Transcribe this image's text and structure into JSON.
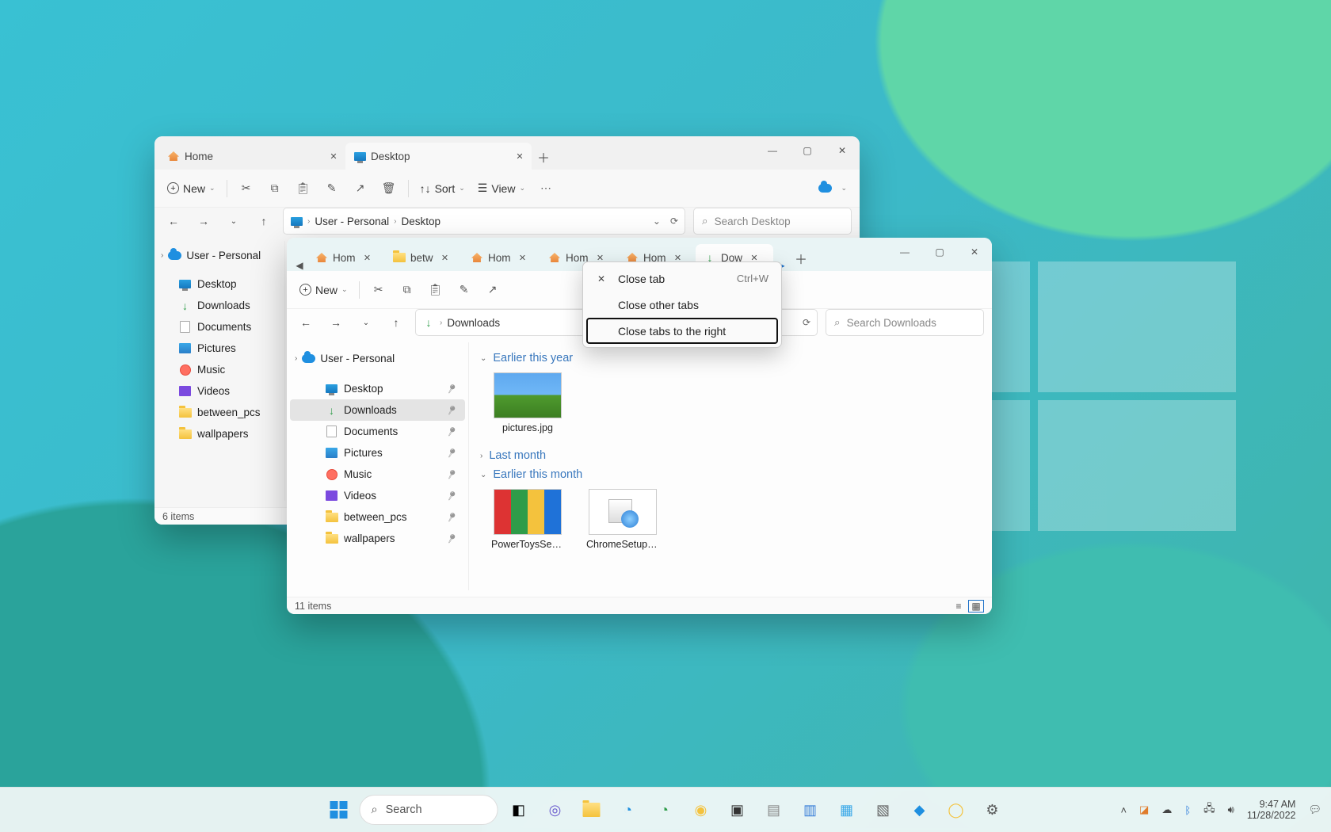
{
  "wallpaper": {
    "win_logo": true
  },
  "back_window": {
    "tabs": [
      {
        "label": "Home",
        "icon": "home",
        "active": false
      },
      {
        "label": "Desktop",
        "icon": "monitor",
        "active": true
      }
    ],
    "toolbar": {
      "new": "New",
      "sort": "Sort",
      "view": "View"
    },
    "breadcrumb": [
      "User - Personal",
      "Desktop"
    ],
    "search_placeholder": "Search Desktop",
    "sidebar_root": "User - Personal",
    "sidebar": [
      {
        "label": "Desktop",
        "icon": "monitor"
      },
      {
        "label": "Downloads",
        "icon": "download"
      },
      {
        "label": "Documents",
        "icon": "doc"
      },
      {
        "label": "Pictures",
        "icon": "pic"
      },
      {
        "label": "Music",
        "icon": "music"
      },
      {
        "label": "Videos",
        "icon": "video"
      },
      {
        "label": "between_pcs",
        "icon": "folder"
      },
      {
        "label": "wallpapers",
        "icon": "folder"
      }
    ],
    "status": "6 items"
  },
  "front_window": {
    "tab_scroll": true,
    "tabs": [
      {
        "label": "Hom",
        "icon": "home"
      },
      {
        "label": "betw",
        "icon": "folder"
      },
      {
        "label": "Hom",
        "icon": "home"
      },
      {
        "label": "Hom",
        "icon": "home"
      },
      {
        "label": "Hom",
        "icon": "home"
      },
      {
        "label": "Dow",
        "icon": "download",
        "active": true
      }
    ],
    "toolbar": {
      "new": "New"
    },
    "breadcrumb_icon": "download",
    "breadcrumb": [
      "Downloads"
    ],
    "search_placeholder": "Search Downloads",
    "sidebar_root": "User - Personal",
    "sidebar": [
      {
        "label": "Desktop",
        "icon": "monitor",
        "pinned": true
      },
      {
        "label": "Downloads",
        "icon": "download",
        "pinned": true,
        "selected": true
      },
      {
        "label": "Documents",
        "icon": "doc",
        "pinned": true
      },
      {
        "label": "Pictures",
        "icon": "pic",
        "pinned": true
      },
      {
        "label": "Music",
        "icon": "music",
        "pinned": true
      },
      {
        "label": "Videos",
        "icon": "video",
        "pinned": true
      },
      {
        "label": "between_pcs",
        "icon": "folder",
        "pinned": true
      },
      {
        "label": "wallpapers",
        "icon": "folder",
        "pinned": true
      }
    ],
    "groups": [
      {
        "title": "Earlier this year",
        "collapsed": false,
        "files": [
          {
            "name": "pictures.jpg",
            "thumb": "bliss"
          }
        ]
      },
      {
        "title": "Last month",
        "collapsed": true,
        "files": []
      },
      {
        "title": "Earlier this month",
        "collapsed": false,
        "files": [
          {
            "name": "PowerToysSetup-",
            "thumb": "powertoys"
          },
          {
            "name": "ChromeSetup.ex",
            "thumb": "exe"
          }
        ]
      }
    ],
    "status": "11 items"
  },
  "context_menu": {
    "items": [
      {
        "label": "Close tab",
        "shortcut": "Ctrl+W",
        "icon": "close"
      },
      {
        "label": "Close other tabs"
      },
      {
        "label": "Close tabs to the right",
        "highlight": true
      }
    ]
  },
  "taskbar": {
    "search": "Search",
    "tray": {
      "time": "9:47 AM",
      "date": "11/28/2022"
    }
  }
}
